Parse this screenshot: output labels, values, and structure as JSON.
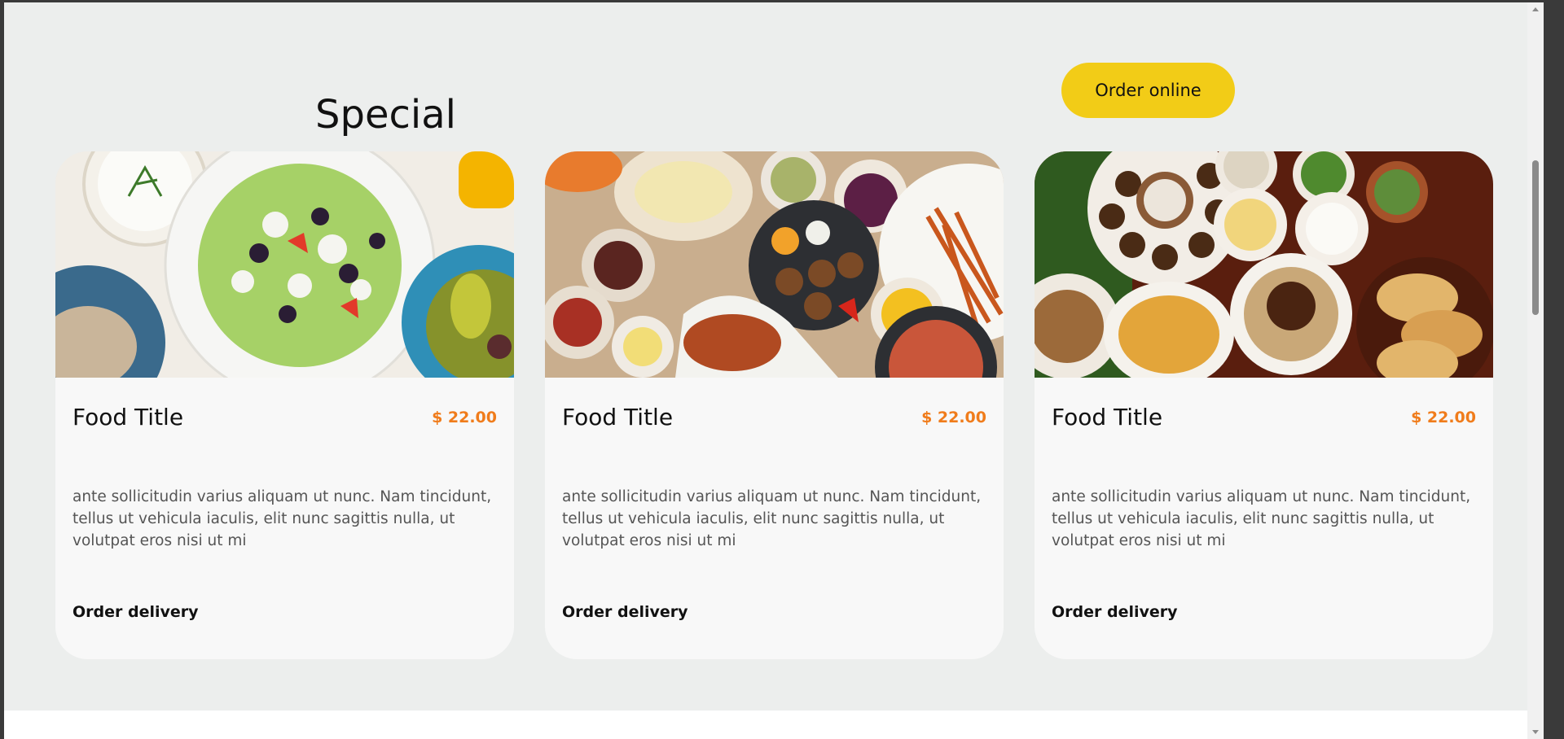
{
  "section": {
    "heading": "Special",
    "order_online_label": "Order online"
  },
  "cards": [
    {
      "title": "Food Title",
      "price": "$ 22.00",
      "description": "ante sollicitudin varius aliquam ut nunc. Nam tincidunt, tellus ut vehicula iaculis, elit nunc sagittis nulla, ut volutpat eros nisi ut mi",
      "action": "Order delivery",
      "image": "greek-salad-plate"
    },
    {
      "title": "Food Title",
      "price": "$ 22.00",
      "description": "ante sollicitudin varius aliquam ut nunc. Nam tincidunt, tellus ut vehicula iaculis, elit nunc sagittis nulla, ut volutpat eros nisi ut mi",
      "action": "Order delivery",
      "image": "middle-eastern-mezze-table"
    },
    {
      "title": "Food Title",
      "price": "$ 22.00",
      "description": "ante sollicitudin varius aliquam ut nunc. Nam tincidunt, tellus ut vehicula iaculis, elit nunc sagittis nulla, ut volutpat eros nisi ut mi",
      "action": "Order delivery",
      "image": "falafel-and-flatbread-spread"
    }
  ],
  "colors": {
    "accent_button": "#f2cc17",
    "price": "#f07c1b",
    "page_background": "#eceeed",
    "card_background": "#f8f8f8"
  }
}
